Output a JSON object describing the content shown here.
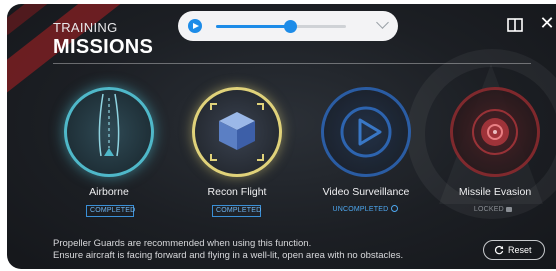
{
  "header": {
    "title_small": "TRAINING",
    "title_big": "MISSIONS"
  },
  "player": {
    "progress": 0.57,
    "accent": "#1d8ce8",
    "play_icon": "play-icon",
    "expand_icon": "chevron-down-icon"
  },
  "toolbar": {
    "book_icon": "book-icon",
    "close_label": "✕"
  },
  "missions": [
    {
      "label": "Airborne",
      "status": "COMPLETED",
      "ring_color": "#4fb8c9",
      "icon": "runway-icon"
    },
    {
      "label": "Recon Flight",
      "status": "COMPLETED",
      "ring_color": "#e0d27a",
      "icon": "cube-icon"
    },
    {
      "label": "Video Surveillance",
      "status": "UNCOMPLETED",
      "ring_color": "#2c66b8",
      "icon": "play-icon"
    },
    {
      "label": "Missile Evasion",
      "status": "LOCKED",
      "ring_color": "#8a2a2e",
      "icon": "target-icon"
    }
  ],
  "footer": {
    "note_line1": "Propeller Guards are recommended when using this function.",
    "note_line2": "Ensure aircraft is facing forward and flying in a well-lit, open area with no obstacles.",
    "reset_label": "Reset"
  }
}
